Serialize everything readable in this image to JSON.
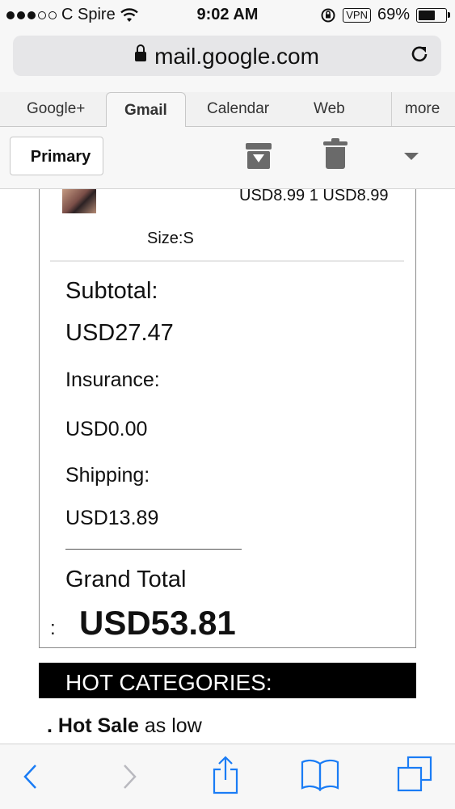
{
  "status_bar": {
    "carrier": "C Spire",
    "time": "9:02 AM",
    "vpn": "VPN",
    "battery_percent": "69%",
    "battery_level": 0.69,
    "signal_bars_filled": 3,
    "signal_bars_total": 5
  },
  "browser": {
    "url": "mail.google.com"
  },
  "tabs": [
    {
      "label": "Google+",
      "active": false
    },
    {
      "label": "Gmail",
      "active": true
    },
    {
      "label": "Calendar",
      "active": false
    },
    {
      "label": "Web",
      "active": false
    },
    {
      "label": "more",
      "active": false
    }
  ],
  "toolbar": {
    "primary_label": "Primary",
    "icons": [
      "archive-icon",
      "trash-icon",
      "dropdown-icon"
    ]
  },
  "order": {
    "price_line": "USD8.99 1 USD8.99",
    "size": "Size:S",
    "subtotal_label": "Subtotal:",
    "subtotal_value": "USD27.47",
    "insurance_label": "Insurance:",
    "insurance_value": "USD0.00",
    "shipping_label": "Shipping:",
    "shipping_value": "USD13.89",
    "grand_total_label": "Grand Total",
    "grand_total_colon": ":",
    "grand_total_value": "USD53.81"
  },
  "hot_categories": {
    "header": "HOT CATEGORIES:",
    "item_prefix": ". ",
    "item_bold": "Hot Sale",
    "item_rest": " as low"
  },
  "bottom_bar": {
    "icons": [
      "back-icon",
      "forward-icon",
      "share-icon",
      "bookmarks-icon",
      "tabs-icon"
    ],
    "accent_color": "#1a7cf5",
    "disabled_color": "#b9b9bf"
  }
}
